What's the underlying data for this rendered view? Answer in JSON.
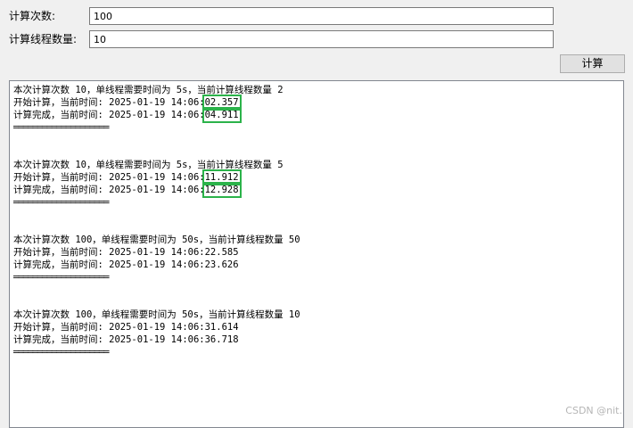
{
  "form": {
    "count_label": "计算次数:",
    "count_value": "100",
    "threads_label": "计算线程数量:",
    "threads_value": "10",
    "compute_button": "计算"
  },
  "output": {
    "separator": "════════════════════",
    "runs": [
      {
        "summary": "本次计算次数 10，单线程需要时间为 5s，当前计算线程数量 2",
        "start_prefix": "开始计算，当前时间: 2025-01-19 14:06:",
        "start_seconds": "02.357",
        "end_prefix": "计算完成，当前时间: 2025-01-19 14:06:",
        "end_seconds": "04.911"
      },
      {
        "summary": "本次计算次数 10，单线程需要时间为 5s，当前计算线程数量 5",
        "start_prefix": "开始计算，当前时间: 2025-01-19 14:06:",
        "start_seconds": "11.912",
        "end_prefix": "计算完成，当前时间: 2025-01-19 14:06:",
        "end_seconds": "12.928"
      },
      {
        "summary": "本次计算次数 100，单线程需要时间为 50s，当前计算线程数量 50",
        "start_prefix": "开始计算，当前时间: 2025-01-19 14:06:",
        "start_seconds": "22.585",
        "end_prefix": "计算完成，当前时间: 2025-01-19 14:06:",
        "end_seconds": "23.626"
      },
      {
        "summary": "本次计算次数 100，单线程需要时间为 50s，当前计算线程数量 10",
        "start_prefix": "开始计算，当前时间: 2025-01-19 14:06:",
        "start_seconds": "31.614",
        "end_prefix": "计算完成，当前时间: 2025-01-19 14:06:",
        "end_seconds": "36.718"
      }
    ]
  },
  "watermark": "CSDN @nit.",
  "colors": {
    "highlight": "#2bb34a",
    "background": "#f0f0f0"
  }
}
